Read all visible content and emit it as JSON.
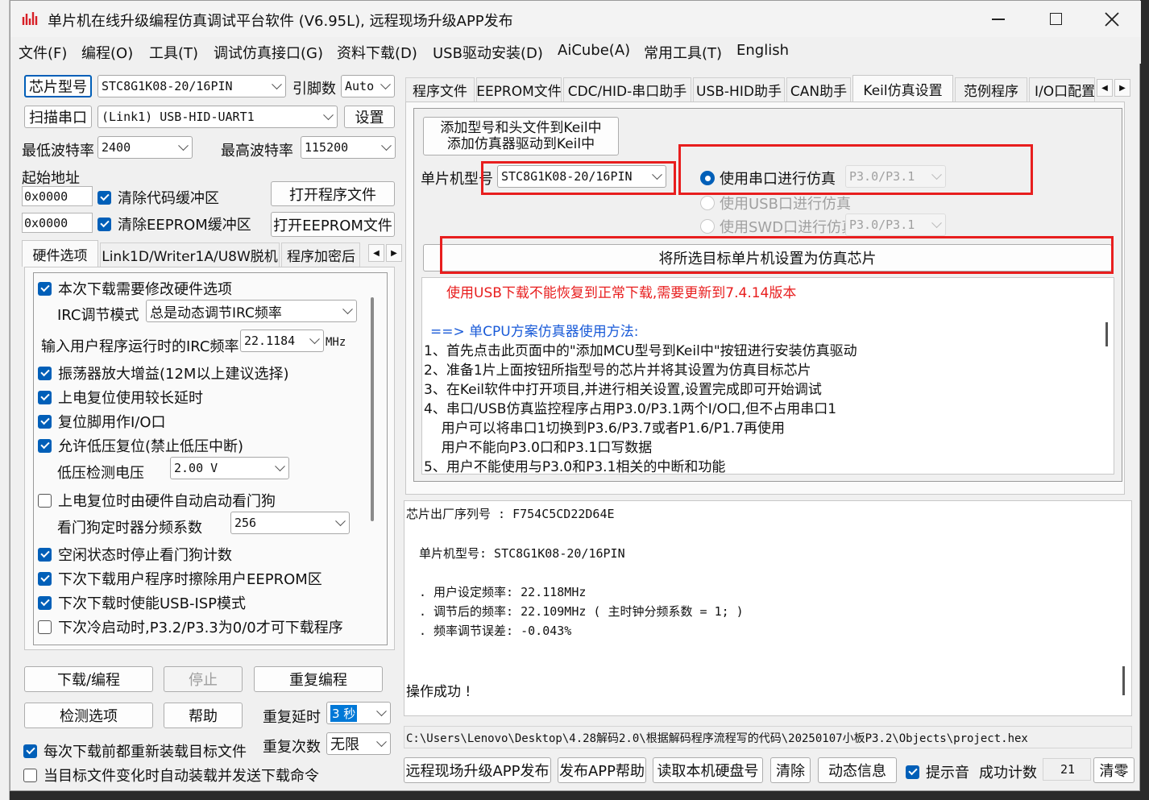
{
  "window": {
    "title": "单片机在线升级编程仿真调试平台软件 (V6.95L), 远程现场升级APP发布"
  },
  "menu": [
    "文件(F)",
    "编程(O)",
    "工具(T)",
    "调试仿真接口(G)",
    "资料下载(D)",
    "USB驱动安装(D)",
    "AiCube(A)",
    "常用工具(T)",
    "English"
  ],
  "left": {
    "chip_btn": "芯片型号",
    "chip_value": "STC8G1K08-20/16PIN",
    "pin_label": "引脚数",
    "pin_value": "Auto",
    "scan_btn": "扫描串口",
    "port_value": "(Link1) USB-HID-UART1",
    "settings_btn": "设置",
    "min_baud_label": "最低波特率",
    "min_baud": "2400",
    "max_baud_label": "最高波特率",
    "max_baud": "115200",
    "start_addr_label": "起始地址",
    "addr1": "0x0000",
    "addr2": "0x0000",
    "clear_code": "清除代码缓冲区",
    "clear_eeprom": "清除EEPROM缓冲区",
    "open_prog_btn": "打开程序文件",
    "open_eeprom_btn": "打开EEPROM文件",
    "tabs": [
      "硬件选项",
      "Link1D/Writer1A/U8W脱机",
      "程序加密后"
    ],
    "hw": {
      "modify_hw": "本次下载需要修改硬件选项",
      "irc_mode_label": "IRC调节模式",
      "irc_mode": "总是动态调节IRC频率",
      "irc_freq_label": "输入用户程序运行时的IRC频率",
      "irc_freq": "22.1184",
      "mhz": "MHz",
      "osc_gain": "振荡器放大增益(12M以上建议选择)",
      "long_reset": "上电复位使用较长延时",
      "reset_io": "复位脚用作I/O口",
      "lvr": "允许低压复位(禁止低压中断)",
      "lv_label": "低压检测电压",
      "lv_value": "2.00 V",
      "wdt_auto": "上电复位时由硬件自动启动看门狗",
      "wdt_div_label": "看门狗定时器分频系数",
      "wdt_div": "256",
      "wdt_idle": "空闲状态时停止看门狗计数",
      "erase_eeprom": "下次下载用户程序时擦除用户EEPROM区",
      "usb_isp": "下次下载时使能USB-ISP模式",
      "cold_boot": "下次冷启动时,P3.2/P3.3为0/0才可下载程序"
    },
    "download_btn": "下载/编程",
    "stop_btn": "停止",
    "reprog_btn": "重复编程",
    "detect_btn": "检测选项",
    "help_btn": "帮助",
    "repeat_delay_label": "重复延时",
    "repeat_delay": "3 秒",
    "repeat_count_label": "重复次数",
    "repeat_count": "无限",
    "reload_each": "每次下载前都重新装载目标文件",
    "auto_reload": "当目标文件变化时自动装载并发送下载命令"
  },
  "right": {
    "tabs": [
      "程序文件",
      "EEPROM文件",
      "CDC/HID-串口助手",
      "USB-HID助手",
      "CAN助手",
      "Keil仿真设置",
      "范例程序",
      "I/O口配置"
    ],
    "add_keil_line1": "添加型号和头文件到Keil中",
    "add_keil_line2": "添加仿真器驱动到Keil中",
    "mcu_label": "单片机型号",
    "mcu_value": "STC8G1K08-20/16PIN",
    "radio_uart": "使用串口进行仿真",
    "radio_uart_pins": "P3.0/P3.1",
    "radio_usb": "使用USB口进行仿真",
    "radio_swd": "使用SWD口进行仿真",
    "radio_swd_pins": "P3.0/P3.1",
    "set_target_btn": "将所选目标单片机设置为仿真芯片",
    "info_warn": "使用USB下载不能恢复到正常下载,需要更新到7.4.14版本",
    "info_head": "==> 单CPU方案仿真器使用方法:",
    "info_lines": [
      "1、首先点击此页面中的\"添加MCU型号到Keil中\"按钮进行安装仿真驱动",
      "2、准备1片上面按钮所指型号的芯片并将其设置为仿真目标芯片",
      "3、在Keil软件中打开项目,并进行相关设置,设置完成即可开始调试",
      "4、串口/USB仿真监控程序占用P3.0/P3.1两个I/O口,但不占用串口1",
      "    用户可以将串口1切换到P3.6/P3.7或者P1.6/P1.7再使用",
      "    用户不能向P3.0口和P3.1口写数据",
      "5、用户不能使用与P3.0和P3.1相关的中断和功能"
    ],
    "log_serial": "芯片出厂序列号 : F754C5CD22D64E",
    "log_mcu": "单片机型号: STC8G1K08-20/16PIN",
    "log_user_freq": ". 用户设定频率: 22.118MHz",
    "log_adj_freq": ". 调节后的频率: 22.109MHz ( 主时钟分频系数 = 1; )",
    "log_err": ". 频率调节误差: -0.043%",
    "log_ok": "操作成功 !",
    "path": "C:\\Users\\Lenovo\\Desktop\\4.28解码2.0\\根据解码程序流程写的代码\\20250107小板P3.2\\Objects\\project.hex",
    "btn_remote": "远程现场升级APP发布",
    "btn_app_help": "发布APP帮助",
    "btn_read_disk": "读取本机硬盘号",
    "btn_clear": "清除",
    "btn_dyn": "动态信息",
    "beep": "提示音",
    "count_label": "成功计数",
    "count": "21",
    "btn_zero": "清零"
  },
  "colors": {
    "accent": "#005fb8",
    "red": "#e81e1e",
    "blue_text": "#1a5bd8"
  }
}
